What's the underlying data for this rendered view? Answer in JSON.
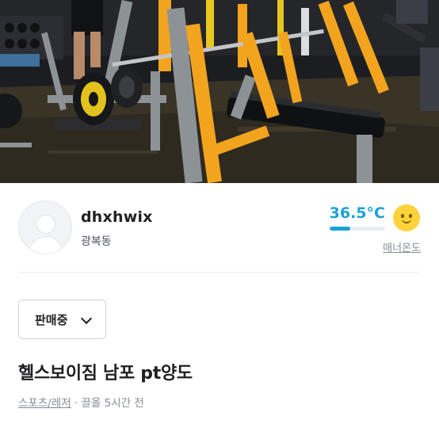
{
  "hero_image": {
    "alt": "gym-photo",
    "colors": {
      "accent_orange": "#f7a21b",
      "frame_gray": "#8c9196",
      "floor": "#3a3528",
      "dark": "#14161a",
      "weight_yellow": "#e2c21c"
    }
  },
  "seller": {
    "username": "dhxhwix",
    "region": "광복동",
    "manner_temperature": "36.5°C",
    "manner_fraction": 0.365,
    "manner_link_label": "매너온도"
  },
  "status": {
    "selected": "판매중"
  },
  "post": {
    "title": "헬스보이짐 남포 pt양도",
    "category": "스포츠/레저",
    "separator": "·",
    "bump_time": "끌올 5시간 전"
  },
  "colors": {
    "temperature_blue": "#1aa1d9",
    "text_primary": "#212124",
    "text_secondary": "#868b94"
  }
}
